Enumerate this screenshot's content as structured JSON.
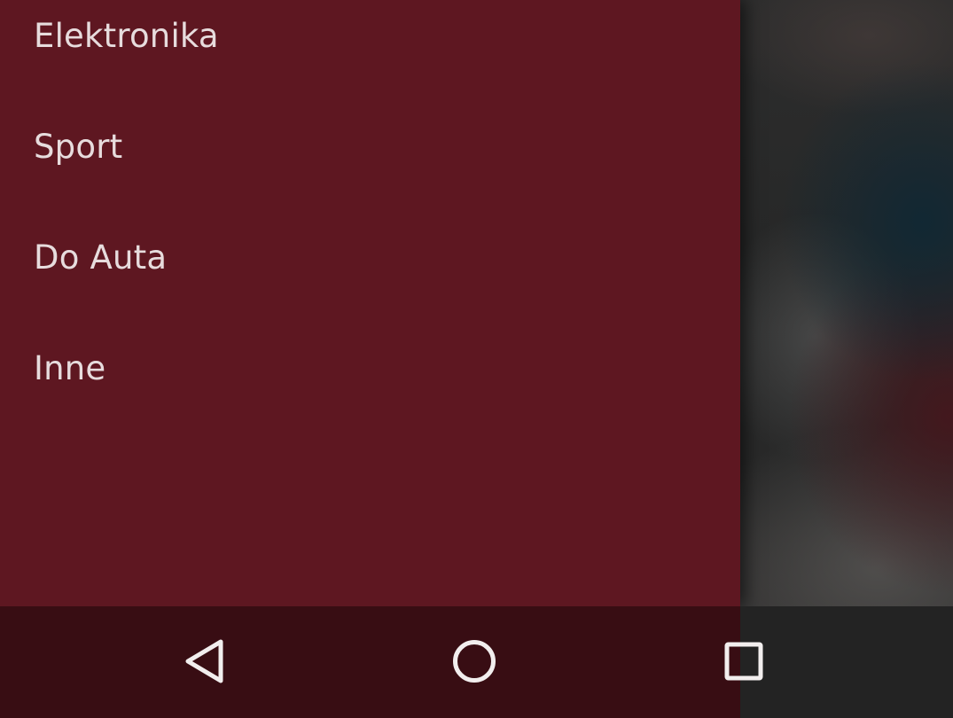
{
  "drawer": {
    "items": [
      {
        "label": "Elektronika"
      },
      {
        "label": "Sport"
      },
      {
        "label": "Do Auta"
      },
      {
        "label": "Inne"
      }
    ]
  },
  "nav_bar": {
    "buttons": [
      {
        "icon": "back-triangle-icon"
      },
      {
        "icon": "home-circle-icon"
      },
      {
        "icon": "recents-square-icon"
      }
    ]
  },
  "colors": {
    "drawer_background": "#5e1721",
    "nav_bar_background": "#380d13",
    "menu_text": "#e7dcdd",
    "nav_icon": "#f2eeee"
  }
}
